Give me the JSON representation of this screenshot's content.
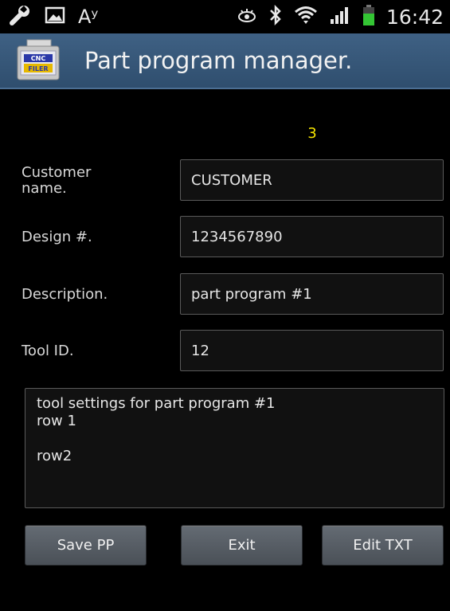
{
  "status_bar": {
    "time": "16:42",
    "icons": [
      "wrench-icon",
      "image-icon",
      "spellcheck-icon",
      "eye-icon",
      "bluetooth-icon",
      "wifi-icon",
      "signal-icon",
      "battery-icon"
    ],
    "left_text_glyph": "Aʸ"
  },
  "app_bar": {
    "logo_text_top": "CNC",
    "logo_text_bottom": "FILER",
    "title": "Part program manager."
  },
  "record_number": "3",
  "fields": {
    "customer": {
      "label": "Customer\nname.",
      "value": "CUSTOMER"
    },
    "design": {
      "label": "Design #.",
      "value": "1234567890"
    },
    "description": {
      "label": "Description.",
      "value": "part program #1"
    },
    "tool_id": {
      "label": "Tool ID.",
      "value": "12"
    }
  },
  "notes": "tool settings for part program #1\nrow 1\n\nrow2",
  "buttons": {
    "save": "Save PP",
    "exit": "Exit",
    "edit": "Edit TXT"
  },
  "colors": {
    "app_bar": "#35557a",
    "record_number": "#f7e600",
    "battery": "#34c534"
  }
}
